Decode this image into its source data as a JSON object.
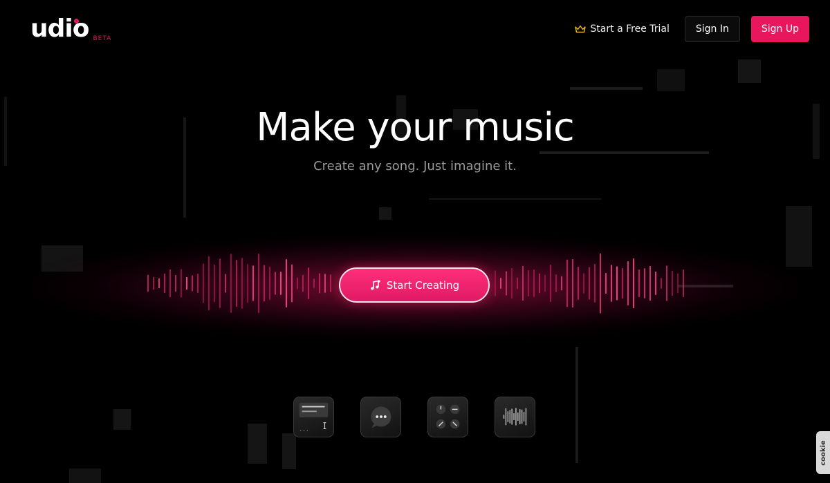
{
  "header": {
    "logo_text": "udio",
    "logo_badge": "BETA",
    "trial_label": "Start a Free Trial",
    "signin_label": "Sign In",
    "signup_label": "Sign Up"
  },
  "hero": {
    "title": "Make your music",
    "subtitle": "Create any song. Just imagine it.",
    "cta_label": "Start Creating"
  },
  "feature_icons": [
    "text-prompt-icon",
    "chat-icon",
    "knobs-icon",
    "waveform-icon"
  ],
  "cookie_label": "cookie",
  "colors": {
    "accent": "#e8175d",
    "background": "#000000",
    "subtitle": "#9a9a9a"
  }
}
